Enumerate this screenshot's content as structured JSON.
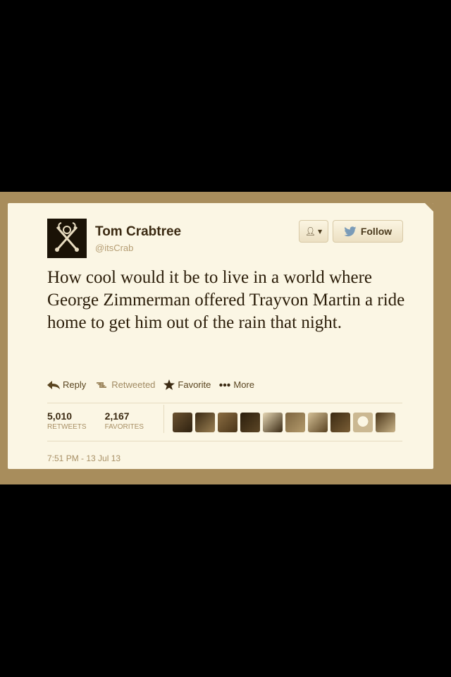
{
  "tweet": {
    "author_name": "Tom Crabtree",
    "author_handle": "@itsCrab",
    "text": "How cool would it be to live in a world where George Zimmerman offered Trayvon Martin a ride home to get him out of the rain that night.",
    "timestamp": "7:51 PM - 13 Jul 13"
  },
  "header": {
    "follow_label": "Follow",
    "user_menu_icon": "user-dropdown-icon"
  },
  "actions": [
    {
      "label": "Reply",
      "icon": "reply-icon"
    },
    {
      "label": "Retweeted",
      "icon": "retweet-icon"
    },
    {
      "label": "Favorite",
      "icon": "star-icon"
    },
    {
      "label": "More",
      "icon": "more-dots-icon"
    }
  ],
  "stats": {
    "retweets_count": "5,010",
    "retweets_label": "RETWEETS",
    "favorites_count": "2,167",
    "favorites_label": "FAVORITES"
  },
  "colors": {
    "frame": "#a88d5c",
    "card": "#fbf6e4",
    "text": "#2a1c08",
    "muted": "#a89066"
  }
}
